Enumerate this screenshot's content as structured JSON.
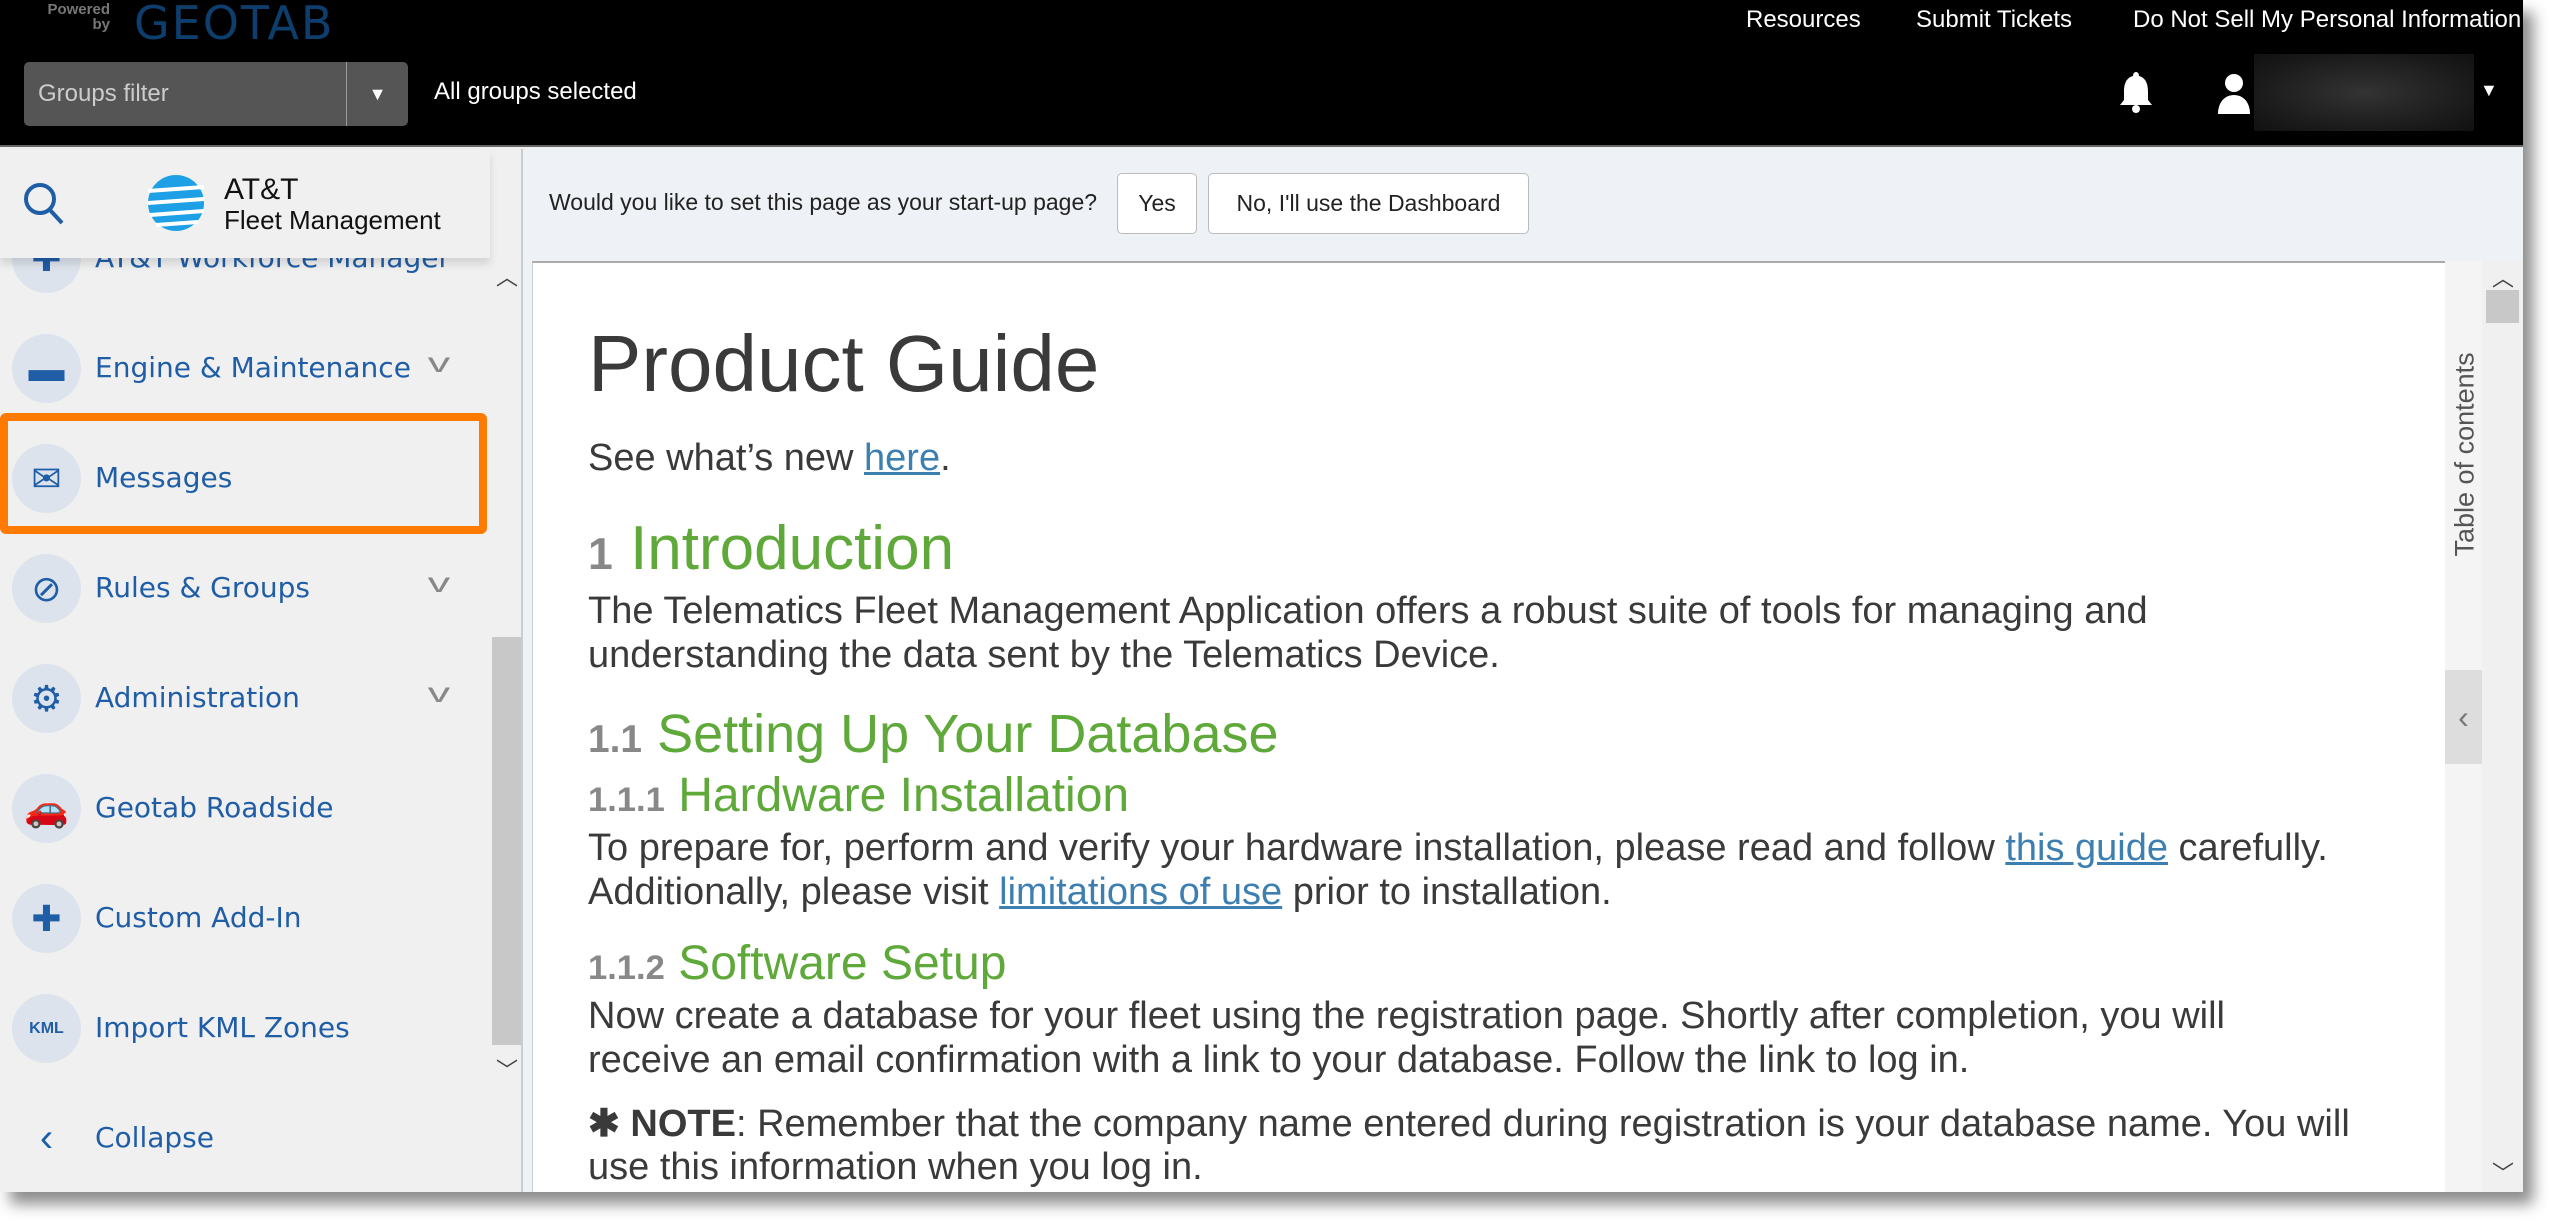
{
  "header": {
    "logo": {
      "powered_by": "Powered by",
      "brand": "GEOTAB"
    },
    "links": [
      "Resources",
      "Submit Tickets",
      "Do Not Sell My Personal Information"
    ],
    "groups_filter": {
      "placeholder": "Groups filter",
      "status": "All groups selected"
    }
  },
  "sidebar": {
    "brand_line1": "AT&T",
    "brand_line2": "Fleet Management",
    "items": [
      {
        "label": "AT&T Workforce Manager",
        "icon": "puzzle-icon"
      },
      {
        "label": "Engine & Maintenance",
        "icon": "engine-icon",
        "expandable": true,
        "highlighted": true
      },
      {
        "label": "Messages",
        "icon": "envelope-icon"
      },
      {
        "label": "Rules & Groups",
        "icon": "rules-icon",
        "expandable": true
      },
      {
        "label": "Administration",
        "icon": "gear-icon",
        "expandable": true
      },
      {
        "label": "Geotab Roadside",
        "icon": "tow-truck-icon"
      },
      {
        "label": "Custom Add-In",
        "icon": "puzzle-icon"
      },
      {
        "label": "Import KML Zones",
        "icon": "kml-file-icon"
      }
    ],
    "collapse": "Collapse"
  },
  "toolbar": {
    "prompt": "Would you like to set this page as your start-up page?",
    "yes": "Yes",
    "no": "No, I'll use the Dashboard"
  },
  "doc": {
    "title": "Product Guide",
    "whats_new_pre": "See what’s new ",
    "whats_new_link": "here",
    "whats_new_post": ".",
    "s1_num": "1",
    "s1_title": "Introduction",
    "s1_body1": "The Telematics Fleet Management Application offers a robust suite of tools for managing and",
    "s1_body2": "understanding the data sent by the Telematics Device.",
    "s11_num": "1.1",
    "s11_title": "Setting Up Your Database",
    "s111_num": "1.1.1",
    "s111_title": "Hardware Installation",
    "s111_l1_pre": "To prepare for, perform and verify your hardware installation, please read and follow ",
    "s111_l1_link": "this guide",
    "s111_l1_post": " carefully.",
    "s111_l2_pre": "Additionally, please visit ",
    "s111_l2_link": "limitations of use",
    "s111_l2_post": " prior to installation.",
    "s112_num": "1.1.2",
    "s112_title": "Software Setup",
    "s112_l1": "Now create a database for your fleet using the registration page. Shortly after completion, you will",
    "s112_l2": "receive an email confirmation with a link to your database. Follow the link to log in.",
    "note_star": "✱ ",
    "note_label": "NOTE",
    "note_l1": ": Remember that the company name entered during registration is your database name. You will",
    "note_l2": "use this information when you log in."
  },
  "toc_label": "Table of contents",
  "colors": {
    "accent_highlight": "#ff7a00",
    "nav_text": "#1f5da6",
    "heading_green": "#5fa83a",
    "link": "#3d7fb0"
  }
}
